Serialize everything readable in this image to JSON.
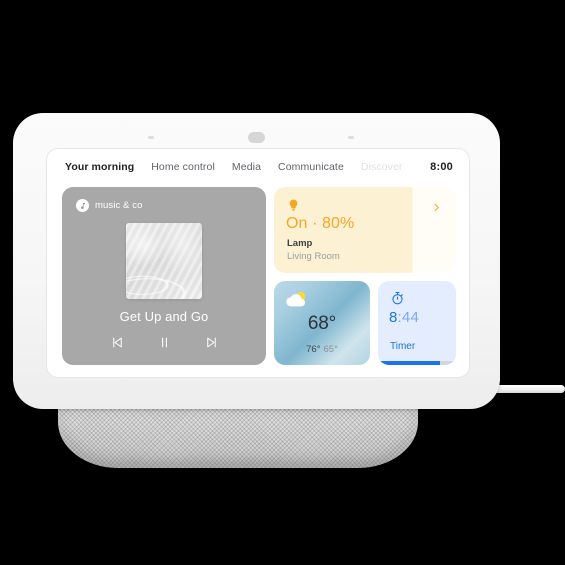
{
  "device": {
    "name": "smart-display",
    "sensors": [
      "mic-sensor-left",
      "camera-sensor-center",
      "mic-sensor-right"
    ]
  },
  "screen": {
    "tabs": [
      {
        "label": "Your morning",
        "state": "active"
      },
      {
        "label": "Home control",
        "state": "normal"
      },
      {
        "label": "Media",
        "state": "normal"
      },
      {
        "label": "Communicate",
        "state": "normal"
      },
      {
        "label": "Discover",
        "state": "muted"
      }
    ],
    "clock": "8:00"
  },
  "music_card": {
    "provider": "music & co",
    "provider_icon": "music-note-icon",
    "album_art": "abstract-wave-artwork",
    "track_title": "Get Up and Go",
    "controls": [
      {
        "name": "previous-track-button",
        "icon": "skip-previous-icon"
      },
      {
        "name": "pause-button",
        "icon": "pause-icon"
      },
      {
        "name": "next-track-button",
        "icon": "skip-next-icon"
      }
    ]
  },
  "lamp_card": {
    "icon": "lightbulb-icon",
    "state": "On · 80%",
    "device_name": "Lamp",
    "room": "Living Room",
    "chevron": "chevron-right-icon",
    "accent_color": "#f5a623",
    "background_color": "#fdf1d3"
  },
  "weather_card": {
    "icon": "sun-behind-cloud-icon",
    "temperature": "68°",
    "high": "76°",
    "low": "65°"
  },
  "timer_card": {
    "icon": "stopwatch-icon",
    "minutes": "8",
    "seconds": ":44",
    "label": "Timer",
    "progress_percent": 80,
    "accent_color": "#1a73e8",
    "background_color": "#e3edfd"
  }
}
